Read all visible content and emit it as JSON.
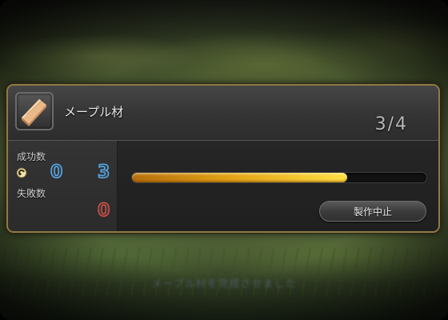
{
  "background": {
    "ghost_caption": "メープル材を完成させました"
  },
  "item": {
    "name": "メープル材",
    "icon": "maple-lumber-icon"
  },
  "progress": {
    "step_text": "3/4",
    "bar_fraction": 0.73
  },
  "stats": {
    "success_label": "成功数",
    "success_value_a": "0",
    "success_value_b": "3",
    "failure_label": "失敗数",
    "failure_value": "0",
    "bonus_icon": "quality-bonus-icon"
  },
  "actions": {
    "cancel_label": "製作中止"
  },
  "colors": {
    "frame": "#8f7a44",
    "bar_start": "#b66e0c",
    "bar_end": "#ffe044",
    "success_digit": "#52a8e8",
    "failure_digit": "#d64c43"
  }
}
